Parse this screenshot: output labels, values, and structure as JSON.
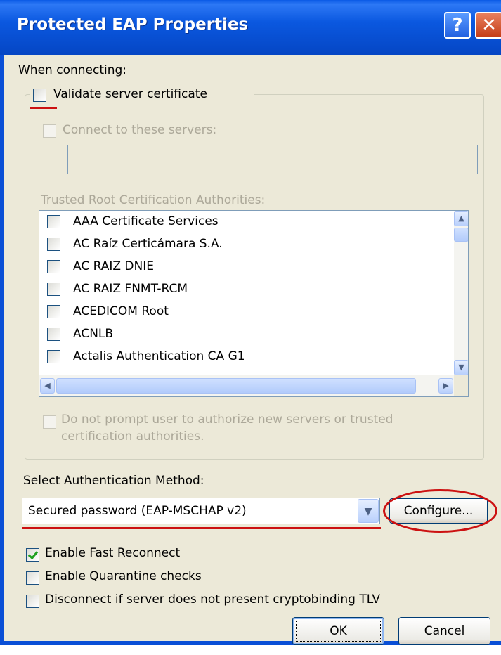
{
  "window": {
    "title": "Protected EAP Properties",
    "help_glyph": "?",
    "close_glyph": "✕"
  },
  "labels": {
    "when_connecting": "When connecting:",
    "validate_server_certificate": "Validate server certificate",
    "connect_to_servers": "Connect to these servers:",
    "trusted_root_ca": "Trusted Root Certification Authorities:",
    "do_not_prompt_line1": "Do not prompt user to authorize new servers or trusted",
    "do_not_prompt_line2": "certification authorities.",
    "select_auth_method": "Select Authentication Method:"
  },
  "trusted_roots": [
    "AAA Certificate Services",
    "AC Raíz Certicámara S.A.",
    "AC RAIZ DNIE",
    "AC RAIZ FNMT-RCM",
    "ACEDICOM Root",
    "ACNLB",
    "Actalis Authentication CA G1"
  ],
  "auth_method": {
    "selected": "Secured password (EAP-MSCHAP v2)"
  },
  "buttons": {
    "configure": "Configure...",
    "ok": "OK",
    "cancel": "Cancel"
  },
  "options": {
    "enable_fast_reconnect": "Enable Fast Reconnect",
    "enable_quarantine_checks": "Enable Quarantine checks",
    "disconnect_cryptobinding": "Disconnect if server does not present cryptobinding TLV"
  },
  "state": {
    "validate_server_certificate": false,
    "enable_fast_reconnect": true,
    "enable_quarantine_checks": false,
    "disconnect_cryptobinding": false
  },
  "colors": {
    "titlebar": "#0a4fd6",
    "dialog_face": "#ece9d8",
    "annotation_red": "#cc1111"
  }
}
